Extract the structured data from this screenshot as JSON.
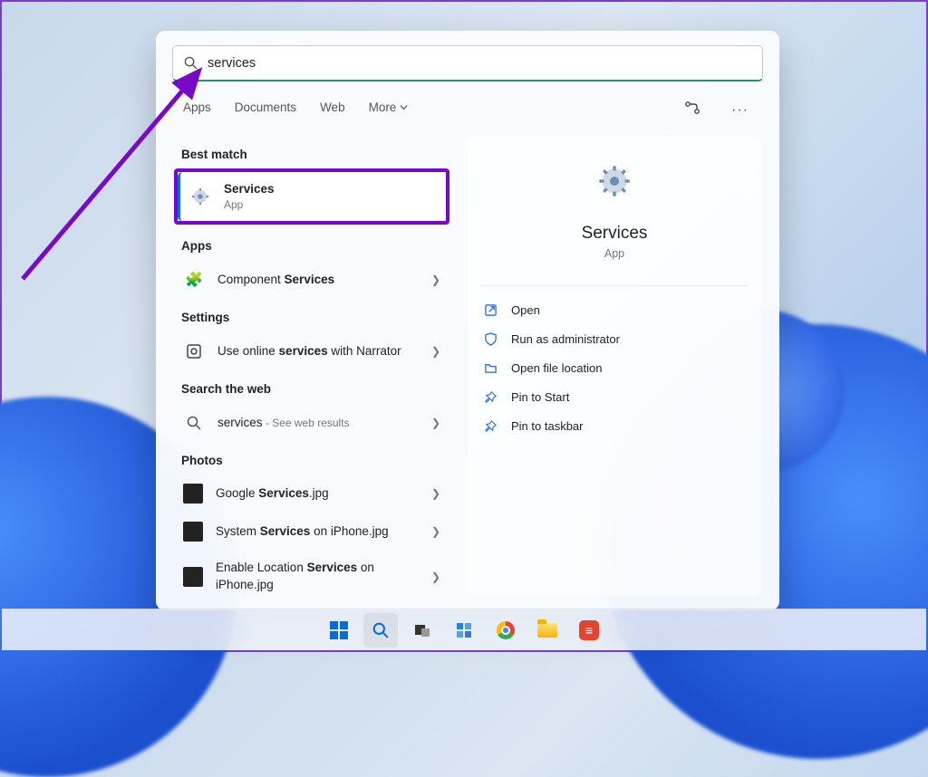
{
  "search": {
    "value": "services"
  },
  "tabs": [
    "Apps",
    "Documents",
    "Web",
    "More"
  ],
  "left": {
    "bestMatchLabel": "Best match",
    "bestMatch": {
      "title": "Services",
      "sub": "App"
    },
    "appsLabel": "Apps",
    "apps": [
      {
        "pre": "Component ",
        "bold": "Services",
        "post": ""
      }
    ],
    "settingsLabel": "Settings",
    "settings": [
      {
        "pre": "Use online ",
        "bold": "services",
        "post": " with Narrator"
      }
    ],
    "webLabel": "Search the web",
    "web": [
      {
        "term": "services",
        "hint": " - See web results"
      }
    ],
    "photosLabel": "Photos",
    "photos": [
      {
        "pre": "Google ",
        "bold": "Services",
        "post": ".jpg"
      },
      {
        "pre": "System ",
        "bold": "Services",
        "post": " on iPhone.jpg"
      },
      {
        "pre": "Enable Location ",
        "bold": "Services",
        "post": " on iPhone.jpg"
      }
    ]
  },
  "detail": {
    "title": "Services",
    "sub": "App",
    "actions": [
      "Open",
      "Run as administrator",
      "Open file location",
      "Pin to Start",
      "Pin to taskbar"
    ]
  }
}
